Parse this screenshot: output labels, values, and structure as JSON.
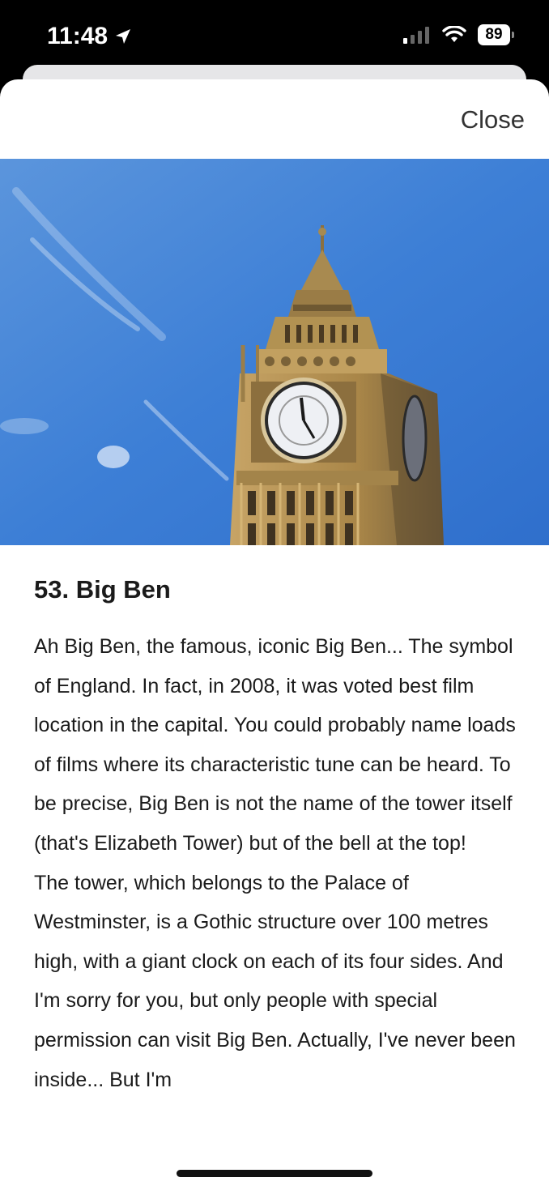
{
  "status_bar": {
    "time": "11:48",
    "battery": "89",
    "icons": [
      "location-arrow-icon",
      "signal-icon",
      "wifi-icon",
      "battery-icon"
    ]
  },
  "sheet": {
    "close_label": "Close"
  },
  "article": {
    "title": "53. Big Ben",
    "paragraph_1": "Ah Big Ben, the famous, iconic Big Ben... The symbol of England. In fact, in 2008, it was voted best film location in the capital. You could probably name loads of films where its characteristic tune can be heard. To be precise, Big Ben is not the name of the tower itself (that's Elizabeth Tower) but of the bell at the top!",
    "paragraph_2": "The tower, which belongs to the Palace of Westminster, is a Gothic structure over 100 metres high, with a giant clock on each of its four sides. And I'm sorry for you, but only people with special permission can visit Big Ben. Actually, I've never been inside... But I'm"
  },
  "colors": {
    "sky": "#3d7fd6",
    "stone": "#b8955a",
    "background": "#ffffff",
    "text": "#1a1a1a"
  }
}
